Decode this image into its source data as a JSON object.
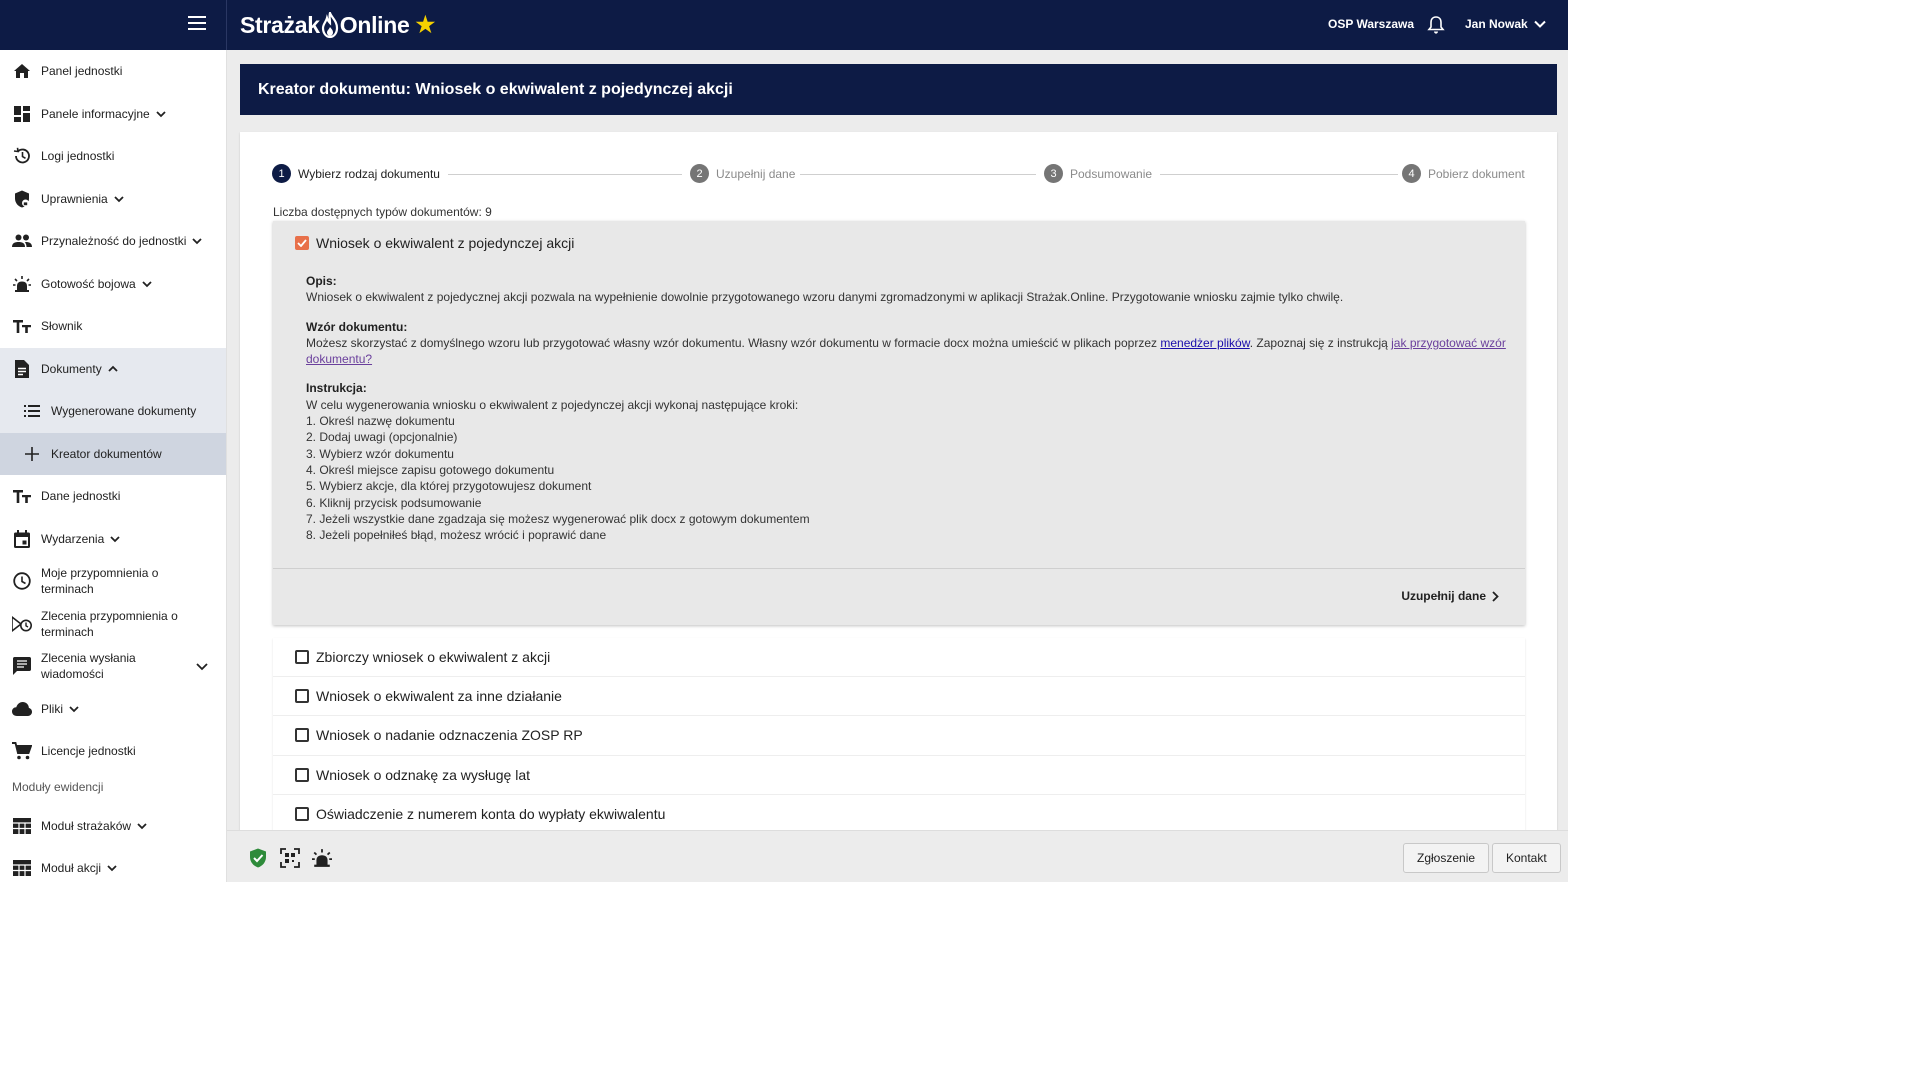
{
  "topbar": {
    "logo_text_left": "Strażak",
    "logo_text_right": "Online",
    "unit": "OSP Warszawa",
    "user": "Jan Nowak"
  },
  "sidebar": {
    "items": [
      {
        "label": "Panel jednostki",
        "icon": "home-icon",
        "chevron": false
      },
      {
        "label": "Panele informacyjne",
        "icon": "dashboard-icon",
        "chevron": true
      },
      {
        "label": "Logi jednostki",
        "icon": "history-icon",
        "chevron": false
      },
      {
        "label": "Uprawnienia",
        "icon": "shield-lock-icon",
        "chevron": true
      },
      {
        "label": "Przynależność do jednostki",
        "icon": "people-icon",
        "chevron": true
      },
      {
        "label": "Gotowość bojowa",
        "icon": "alarm-light-icon",
        "chevron": true
      },
      {
        "label": "Słownik",
        "icon": "text-icon",
        "chevron": false
      },
      {
        "label": "Dokumenty",
        "icon": "document-icon",
        "chevron": "up"
      },
      {
        "label": "Wygenerowane dokumenty",
        "icon": "list-icon",
        "sub": true
      },
      {
        "label": "Kreator dokumentów",
        "icon": "plus-icon",
        "sub": true,
        "active": true
      },
      {
        "label": "Dane jednostki",
        "icon": "text-icon",
        "chevron": false
      },
      {
        "label": "Wydarzenia",
        "icon": "calendar-icon",
        "chevron": true
      },
      {
        "label": "Moje przypomnienia o terminach",
        "icon": "clock-icon",
        "chevron": false
      },
      {
        "label": "Zlecenia przypomnienia o terminach",
        "icon": "clock-send-icon",
        "chevron": false
      },
      {
        "label": "Zlecenia wysłania wiadomości",
        "icon": "message-icon",
        "chevron": "right-down"
      },
      {
        "label": "Pliki",
        "icon": "cloud-icon",
        "chevron": true
      },
      {
        "label": "Licencje jednostki",
        "icon": "cart-icon",
        "chevron": false
      }
    ],
    "section_label": "Moduły ewidencji",
    "modules": [
      {
        "label": "Moduł strażaków",
        "icon": "table-icon"
      },
      {
        "label": "Moduł akcji",
        "icon": "table-icon"
      }
    ]
  },
  "main": {
    "title": "Kreator dokumentu: Wniosek o ekwiwalent z pojedynczej akcji",
    "steps": [
      {
        "num": "1",
        "label": "Wybierz rodzaj dokumentu",
        "active": true
      },
      {
        "num": "2",
        "label": "Uzupełnij dane",
        "active": false
      },
      {
        "num": "3",
        "label": "Podsumowanie",
        "active": false
      },
      {
        "num": "4",
        "label": "Pobierz dokument",
        "active": false
      }
    ],
    "doc_count": "Liczba dostępnych typów dokumentów: 9",
    "selected_doc": {
      "title": "Wniosek o ekwiwalent z pojedynczej akcji",
      "opis_h": "Opis:",
      "opis": "Wniosek o ekwiwalent z pojedycznej akcji pozwala na wypełnienie dowolnie przygotowanego wzoru danymi zgromadzonymi w aplikacji Strażak.Online. Przygotowanie wniosku zajmie tylko chwilę.",
      "wzor_h": "Wzór dokumentu:",
      "wzor_1": "Możesz skorzystać z domyślnego wzoru lub przygotować własny wzór dokumentu. Własny wzór dokumentu w formacie docx można umieścić w plikach poprzez ",
      "wzor_link1": "menedżer plików",
      "wzor_2": ". Zapoznaj się z instrukcją ",
      "wzor_link2": "jak przygotować wzór dokumentu?",
      "instr_h": "Instrukcja:",
      "instr_intro": "W celu wygenerowania wniosku o ekwiwalent z pojedynczej akcji wykonaj następujące kroki:",
      "instr_steps": [
        "1. Określ nazwę dokumentu",
        "2. Dodaj uwagi (opcjonalnie)",
        "3. Wybierz wzór dokumentu",
        "4. Określ miejsce zapisu gotowego dokumentu",
        "5. Wybierz akcje, dla której przygotowujesz dokument",
        "6. Kliknij przycisk podsumowanie",
        "7. Jeżeli wszystkie dane zgadzaja się możesz wygenerować plik docx z gotowym dokumentem",
        "8. Jeżeli popełniłeś błąd, możesz wrócić i poprawić dane"
      ],
      "next_label": "Uzupełnij dane"
    },
    "other_docs": [
      "Zbiorczy wniosek o ekwiwalent z akcji",
      "Wniosek o ekwiwalent za inne działanie",
      "Wniosek o nadanie odznaczenia ZOSP RP",
      "Wniosek o odznakę za wysługę lat",
      "Oświadczenie z numerem konta do wypłaty ekwiwalentu"
    ]
  },
  "footer": {
    "report_label": "Zgłoszenie",
    "contact_label": "Kontakt"
  },
  "colors": {
    "navy": "#0d1b45",
    "accent_checkbox": "#e8704a",
    "star": "#f5d000",
    "shield_green": "#2e8b3a"
  }
}
